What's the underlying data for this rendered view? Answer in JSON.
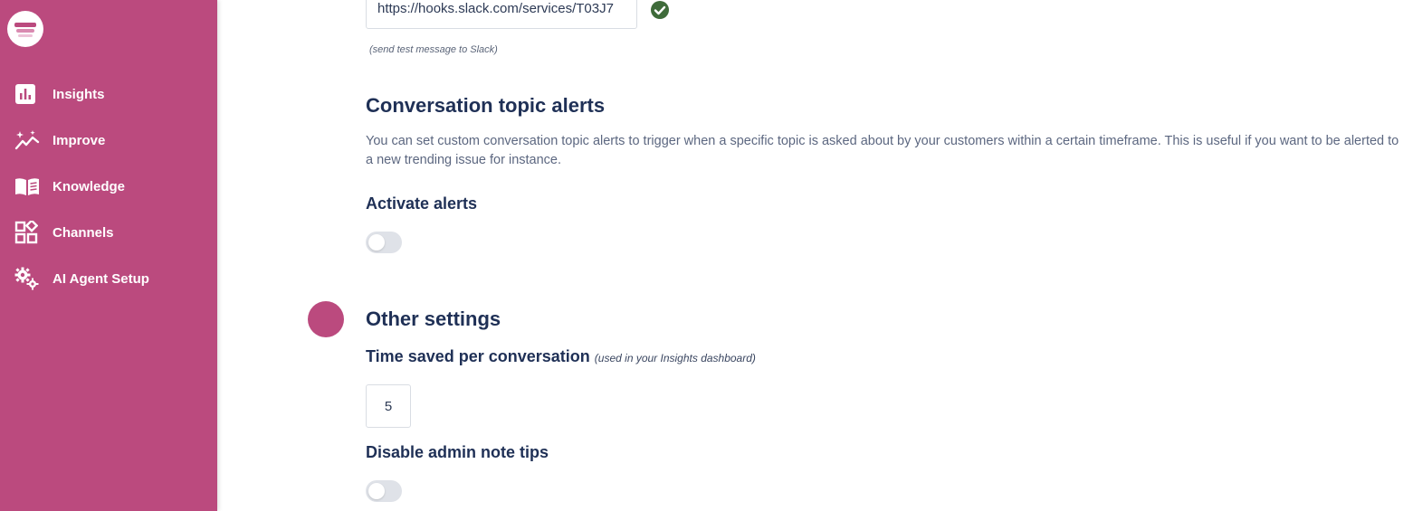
{
  "sidebar": {
    "items": [
      {
        "label": "Insights",
        "icon": "bar-chart-icon"
      },
      {
        "label": "Improve",
        "icon": "sparkle-trend-icon"
      },
      {
        "label": "Knowledge",
        "icon": "book-icon"
      },
      {
        "label": "Channels",
        "icon": "grid-shapes-icon"
      },
      {
        "label": "AI Agent Setup",
        "icon": "gears-icon"
      }
    ]
  },
  "slack": {
    "webhook_value": "https://hooks.slack.com/services/T03J7",
    "test_hint": "(send test message to Slack)"
  },
  "topic_alerts": {
    "title": "Conversation topic alerts",
    "description": "You can set custom conversation topic alerts to trigger when a specific topic is asked about by your customers within a certain timeframe. This is useful if you want to be alerted to a new trending issue for instance.",
    "activate_label": "Activate alerts",
    "activate_enabled": false
  },
  "other_settings": {
    "title": "Other settings",
    "time_saved_label": "Time saved per conversation",
    "time_saved_note": "(used in your Insights dashboard)",
    "time_saved_value": "5",
    "disable_tips_label": "Disable admin note tips",
    "disable_tips_enabled": false
  },
  "colors": {
    "brand": "#bb4a7e",
    "check": "#3f6b3a",
    "heading": "#1f3056"
  }
}
